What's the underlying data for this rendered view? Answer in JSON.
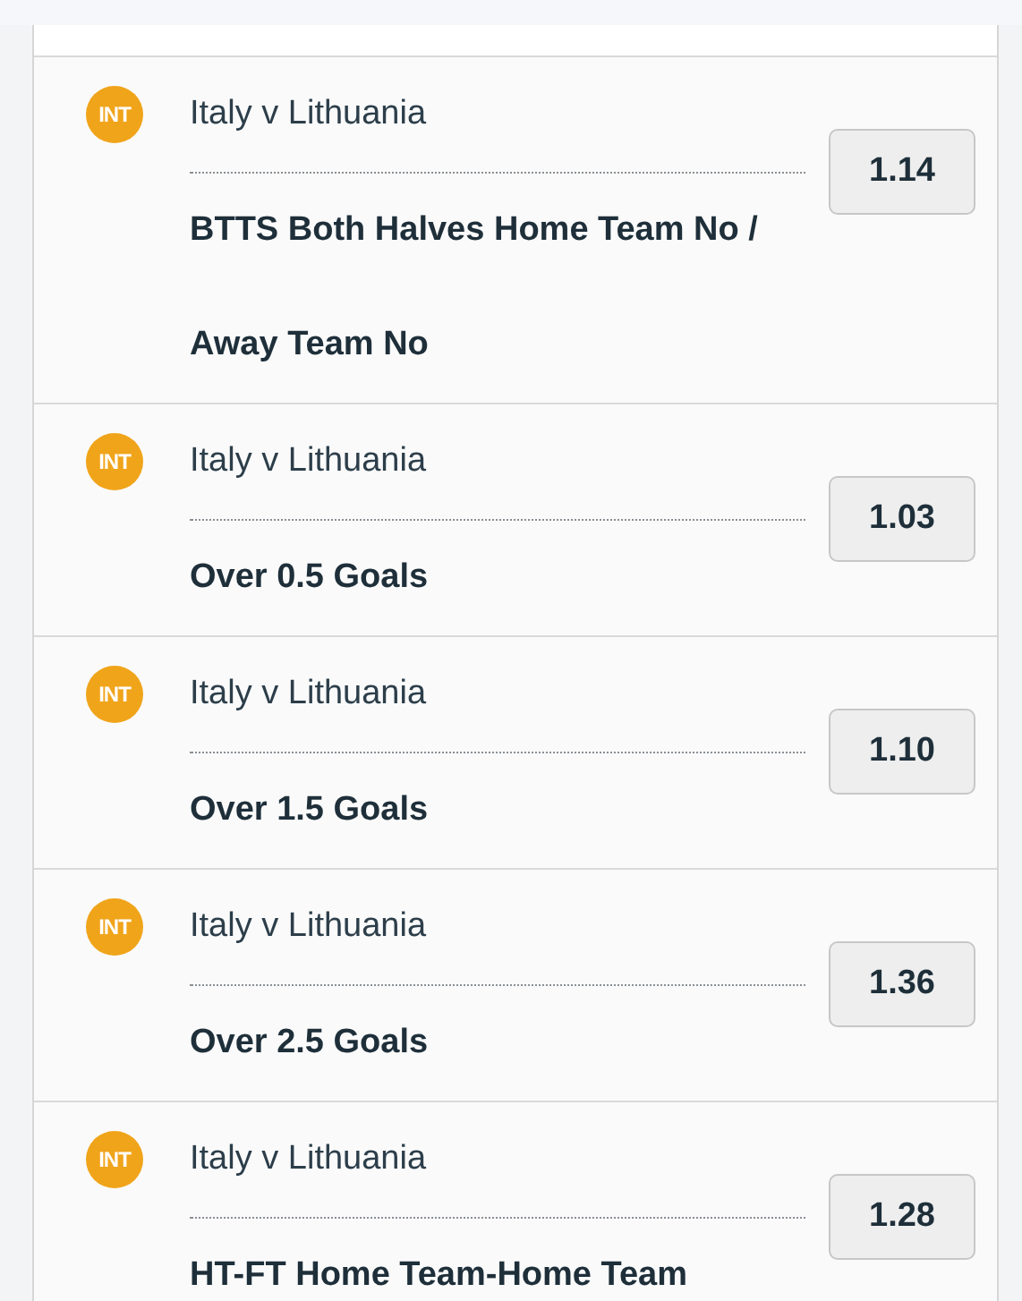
{
  "bets": [
    {
      "badge": "INT",
      "match": "Italy v Lithuania",
      "market": "BTTS Both Halves Home Team No / Away Team No",
      "odds": "1.14"
    },
    {
      "badge": "INT",
      "match": "Italy v Lithuania",
      "market": "Over 0.5 Goals",
      "odds": "1.03"
    },
    {
      "badge": "INT",
      "match": "Italy v Lithuania",
      "market": "Over 1.5 Goals",
      "odds": "1.10"
    },
    {
      "badge": "INT",
      "match": "Italy v Lithuania",
      "market": "Over 2.5 Goals",
      "odds": "1.36"
    },
    {
      "badge": "INT",
      "match": "Italy v Lithuania",
      "market": "HT-FT Home Team-Home Team",
      "odds": "1.28"
    }
  ]
}
